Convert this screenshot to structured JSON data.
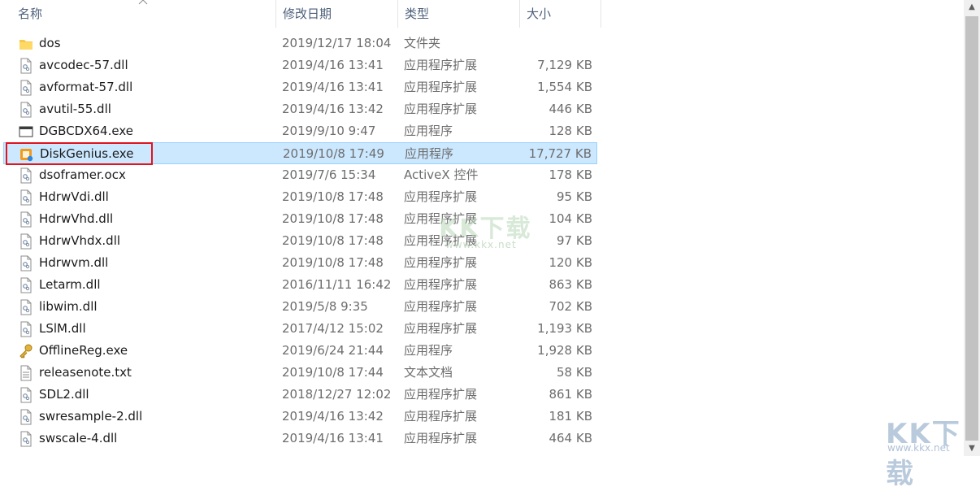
{
  "columns": {
    "name": "名称",
    "date": "修改日期",
    "type": "类型",
    "size": "大小"
  },
  "files": [
    {
      "name": "dos",
      "date": "2019/12/17 18:04",
      "type": "文件夹",
      "size": "",
      "icon": "folder-icon"
    },
    {
      "name": "avcodec-57.dll",
      "date": "2019/4/16 13:41",
      "type": "应用程序扩展",
      "size": "7,129 KB",
      "icon": "dll-file-icon"
    },
    {
      "name": "avformat-57.dll",
      "date": "2019/4/16 13:41",
      "type": "应用程序扩展",
      "size": "1,554 KB",
      "icon": "dll-file-icon"
    },
    {
      "name": "avutil-55.dll",
      "date": "2019/4/16 13:42",
      "type": "应用程序扩展",
      "size": "446 KB",
      "icon": "dll-file-icon"
    },
    {
      "name": "DGBCDX64.exe",
      "date": "2019/9/10 9:47",
      "type": "应用程序",
      "size": "128 KB",
      "icon": "window-exe-icon"
    },
    {
      "name": "DiskGenius.exe",
      "date": "2019/10/8 17:49",
      "type": "应用程序",
      "size": "17,727 KB",
      "icon": "diskgenius-icon",
      "selected": true
    },
    {
      "name": "dsoframer.ocx",
      "date": "2019/7/6 15:34",
      "type": "ActiveX 控件",
      "size": "178 KB",
      "icon": "dll-file-icon"
    },
    {
      "name": "HdrwVdi.dll",
      "date": "2019/10/8 17:48",
      "type": "应用程序扩展",
      "size": "95 KB",
      "icon": "dll-file-icon"
    },
    {
      "name": "HdrwVhd.dll",
      "date": "2019/10/8 17:48",
      "type": "应用程序扩展",
      "size": "104 KB",
      "icon": "dll-file-icon"
    },
    {
      "name": "HdrwVhdx.dll",
      "date": "2019/10/8 17:48",
      "type": "应用程序扩展",
      "size": "97 KB",
      "icon": "dll-file-icon"
    },
    {
      "name": "Hdrwvm.dll",
      "date": "2019/10/8 17:48",
      "type": "应用程序扩展",
      "size": "120 KB",
      "icon": "dll-file-icon"
    },
    {
      "name": "Letarm.dll",
      "date": "2016/11/11 16:42",
      "type": "应用程序扩展",
      "size": "863 KB",
      "icon": "dll-file-icon"
    },
    {
      "name": "libwim.dll",
      "date": "2019/5/8 9:35",
      "type": "应用程序扩展",
      "size": "702 KB",
      "icon": "dll-file-icon"
    },
    {
      "name": "LSlM.dll",
      "date": "2017/4/12 15:02",
      "type": "应用程序扩展",
      "size": "1,193 KB",
      "icon": "dll-file-icon"
    },
    {
      "name": "OfflineReg.exe",
      "date": "2019/6/24 21:44",
      "type": "应用程序",
      "size": "1,928 KB",
      "icon": "key-icon"
    },
    {
      "name": "releasenote.txt",
      "date": "2019/10/8 17:44",
      "type": "文本文档",
      "size": "58 KB",
      "icon": "text-file-icon"
    },
    {
      "name": "SDL2.dll",
      "date": "2018/12/27 12:02",
      "type": "应用程序扩展",
      "size": "861 KB",
      "icon": "dll-file-icon"
    },
    {
      "name": "swresample-2.dll",
      "date": "2019/4/16 13:42",
      "type": "应用程序扩展",
      "size": "181 KB",
      "icon": "dll-file-icon"
    },
    {
      "name": "swscale-4.dll",
      "date": "2019/4/16 13:41",
      "type": "应用程序扩展",
      "size": "464 KB",
      "icon": "dll-file-icon"
    }
  ],
  "watermark": {
    "main": "KK下载",
    "url": "www.kkx.net"
  },
  "colors": {
    "selection_bg": "#cce8ff",
    "selection_border": "#99d1ff",
    "highlight_red": "#e0141e",
    "header_text": "#4c607a"
  }
}
